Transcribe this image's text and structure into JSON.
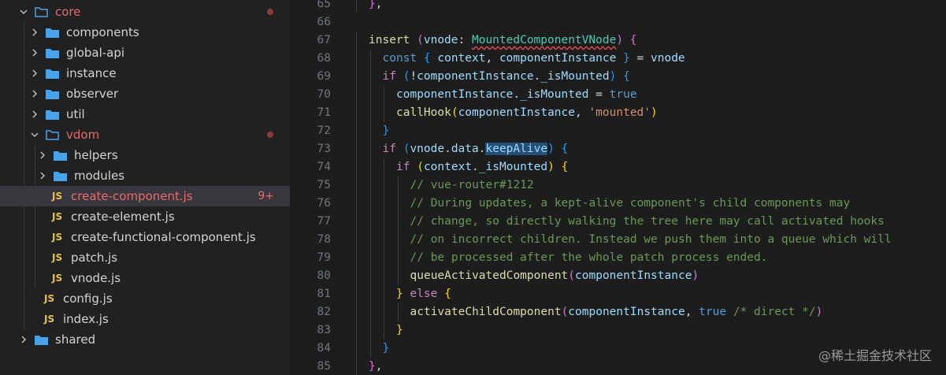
{
  "explorer": {
    "items": [
      {
        "label": "core",
        "type": "folder",
        "open": true,
        "depth": 0,
        "color": "red"
      },
      {
        "label": "components",
        "type": "folder",
        "open": false,
        "depth": 1
      },
      {
        "label": "global-api",
        "type": "folder",
        "open": false,
        "depth": 1
      },
      {
        "label": "instance",
        "type": "folder",
        "open": false,
        "depth": 1
      },
      {
        "label": "observer",
        "type": "folder",
        "open": false,
        "depth": 1
      },
      {
        "label": "util",
        "type": "folder",
        "open": false,
        "depth": 1
      },
      {
        "label": "vdom",
        "type": "folder",
        "open": true,
        "depth": 1,
        "color": "red"
      },
      {
        "label": "helpers",
        "type": "folder",
        "open": false,
        "depth": 2
      },
      {
        "label": "modules",
        "type": "folder",
        "open": false,
        "depth": 2
      },
      {
        "label": "create-component.js",
        "type": "js",
        "depth": 2,
        "color": "red",
        "selected": true,
        "badge": "9+"
      },
      {
        "label": "create-element.js",
        "type": "js",
        "depth": 2
      },
      {
        "label": "create-functional-component.js",
        "type": "js",
        "depth": 2
      },
      {
        "label": "patch.js",
        "type": "js",
        "depth": 2
      },
      {
        "label": "vnode.js",
        "type": "js",
        "depth": 2
      },
      {
        "label": "config.js",
        "type": "js",
        "depth": 1
      },
      {
        "label": "index.js",
        "type": "js",
        "depth": 1
      },
      {
        "label": "shared",
        "type": "folder",
        "open": false,
        "depth": 0
      }
    ],
    "js_icon_text": "JS"
  },
  "editor": {
    "lines": [
      {
        "n": "65",
        "indent": 1,
        "t": [
          [
            "tok-br2",
            "}"
          ],
          [
            "tok-p",
            ","
          ]
        ]
      },
      {
        "n": "66",
        "indent": 0,
        "t": []
      },
      {
        "n": "67",
        "indent": 1,
        "t": [
          [
            "tok-fn",
            "insert"
          ],
          [
            "tok-p",
            " "
          ],
          [
            "tok-br2",
            "("
          ],
          [
            "tok-var",
            "vnode"
          ],
          [
            "tok-p",
            ": "
          ],
          [
            "tok-type",
            "MountedComponentVNode"
          ],
          [
            "tok-br2",
            ")"
          ],
          [
            "tok-p",
            " "
          ],
          [
            "tok-br2",
            "{"
          ]
        ]
      },
      {
        "n": "68",
        "indent": 2,
        "t": [
          [
            "tok-kw",
            "const"
          ],
          [
            "tok-p",
            " "
          ],
          [
            "tok-br3",
            "{"
          ],
          [
            "tok-p",
            " "
          ],
          [
            "tok-var",
            "context"
          ],
          [
            "tok-p",
            ", "
          ],
          [
            "tok-var",
            "componentInstance"
          ],
          [
            "tok-p",
            " "
          ],
          [
            "tok-br3",
            "}"
          ],
          [
            "tok-p",
            " = "
          ],
          [
            "tok-var",
            "vnode"
          ]
        ]
      },
      {
        "n": "69",
        "indent": 2,
        "t": [
          [
            "tok-ctl",
            "if"
          ],
          [
            "tok-p",
            " "
          ],
          [
            "tok-br3",
            "("
          ],
          [
            "tok-p",
            "!"
          ],
          [
            "tok-var",
            "componentInstance"
          ],
          [
            "tok-p",
            "."
          ],
          [
            "tok-var",
            "_isMounted"
          ],
          [
            "tok-br3",
            ")"
          ],
          [
            "tok-p",
            " "
          ],
          [
            "tok-br3",
            "{"
          ]
        ]
      },
      {
        "n": "70",
        "indent": 3,
        "t": [
          [
            "tok-var",
            "componentInstance"
          ],
          [
            "tok-p",
            "."
          ],
          [
            "tok-var",
            "_isMounted"
          ],
          [
            "tok-p",
            " = "
          ],
          [
            "tok-kw",
            "true"
          ]
        ]
      },
      {
        "n": "71",
        "indent": 3,
        "t": [
          [
            "tok-fn",
            "callHook"
          ],
          [
            "tok-br1",
            "("
          ],
          [
            "tok-var",
            "componentInstance"
          ],
          [
            "tok-p",
            ", "
          ],
          [
            "tok-str",
            "'mounted'"
          ],
          [
            "tok-br1",
            ")"
          ]
        ]
      },
      {
        "n": "72",
        "indent": 2,
        "t": [
          [
            "tok-br3",
            "}"
          ]
        ]
      },
      {
        "n": "73",
        "indent": 2,
        "t": [
          [
            "tok-ctl",
            "if"
          ],
          [
            "tok-p",
            " "
          ],
          [
            "tok-br3",
            "("
          ],
          [
            "tok-var",
            "vnode"
          ],
          [
            "tok-p",
            "."
          ],
          [
            "tok-var",
            "data"
          ],
          [
            "tok-p",
            "."
          ],
          [
            "tok-hl",
            "keepAlive"
          ],
          [
            "tok-br3",
            ")"
          ],
          [
            "tok-p",
            " "
          ],
          [
            "tok-br3",
            "{"
          ]
        ]
      },
      {
        "n": "74",
        "indent": 3,
        "t": [
          [
            "tok-ctl",
            "if"
          ],
          [
            "tok-p",
            " "
          ],
          [
            "tok-br1",
            "("
          ],
          [
            "tok-var",
            "context"
          ],
          [
            "tok-p",
            "."
          ],
          [
            "tok-var",
            "_isMounted"
          ],
          [
            "tok-br1",
            ")"
          ],
          [
            "tok-p",
            " "
          ],
          [
            "tok-br1",
            "{"
          ]
        ]
      },
      {
        "n": "75",
        "indent": 4,
        "t": [
          [
            "tok-com",
            "// vue-router#1212"
          ]
        ]
      },
      {
        "n": "76",
        "indent": 4,
        "t": [
          [
            "tok-com",
            "// During updates, a kept-alive component's child components may"
          ]
        ]
      },
      {
        "n": "77",
        "indent": 4,
        "t": [
          [
            "tok-com",
            "// change, so directly walking the tree here may call activated hooks"
          ]
        ]
      },
      {
        "n": "78",
        "indent": 4,
        "t": [
          [
            "tok-com",
            "// on incorrect children. Instead we push them into a queue which will"
          ]
        ]
      },
      {
        "n": "79",
        "indent": 4,
        "t": [
          [
            "tok-com",
            "// be processed after the whole patch process ended."
          ]
        ]
      },
      {
        "n": "80",
        "indent": 4,
        "t": [
          [
            "tok-fn",
            "queueActivatedComponent"
          ],
          [
            "tok-br2",
            "("
          ],
          [
            "tok-var",
            "componentInstance"
          ],
          [
            "tok-br2",
            ")"
          ]
        ]
      },
      {
        "n": "81",
        "indent": 3,
        "t": [
          [
            "tok-br1",
            "}"
          ],
          [
            "tok-p",
            " "
          ],
          [
            "tok-ctl",
            "else"
          ],
          [
            "tok-p",
            " "
          ],
          [
            "tok-br1",
            "{"
          ]
        ]
      },
      {
        "n": "82",
        "indent": 4,
        "t": [
          [
            "tok-fn",
            "activateChildComponent"
          ],
          [
            "tok-br2",
            "("
          ],
          [
            "tok-var",
            "componentInstance"
          ],
          [
            "tok-p",
            ", "
          ],
          [
            "tok-kw",
            "true"
          ],
          [
            "tok-p",
            " "
          ],
          [
            "tok-com",
            "/* direct */"
          ],
          [
            "tok-br2",
            ")"
          ]
        ]
      },
      {
        "n": "83",
        "indent": 3,
        "t": [
          [
            "tok-br1",
            "}"
          ]
        ]
      },
      {
        "n": "84",
        "indent": 2,
        "t": [
          [
            "tok-br3",
            "}"
          ]
        ]
      },
      {
        "n": "85",
        "indent": 1,
        "t": [
          [
            "tok-br2",
            "}"
          ],
          [
            "tok-p",
            ","
          ]
        ]
      }
    ]
  },
  "watermark": "@稀土掘金技术社区"
}
